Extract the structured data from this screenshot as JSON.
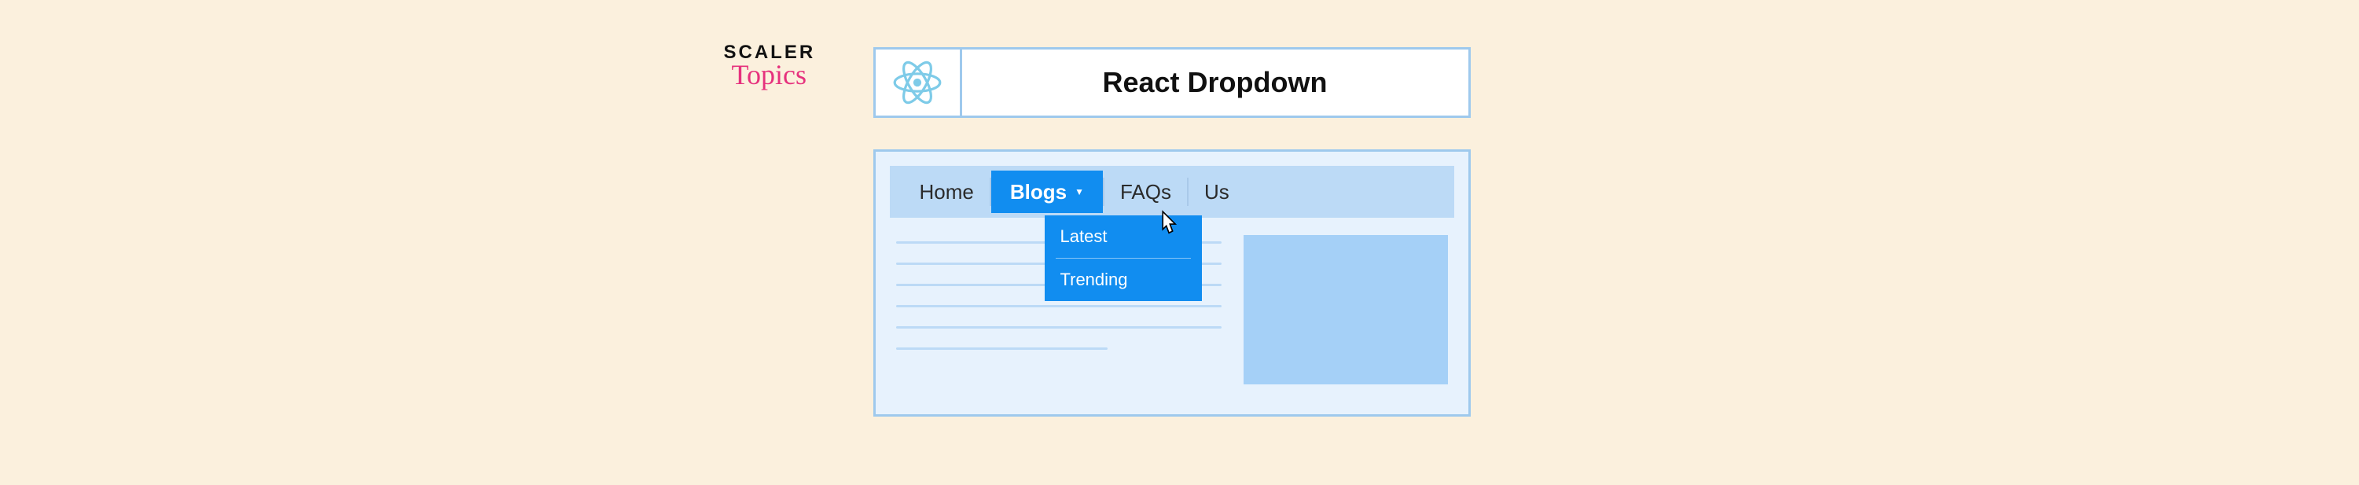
{
  "logo": {
    "scaler": "SCALER",
    "topics": "Topics"
  },
  "titlebar": {
    "title": "React Dropdown",
    "icon": "react-icon"
  },
  "nav": {
    "items": [
      {
        "label": "Home",
        "active": false
      },
      {
        "label": "Blogs",
        "active": true
      },
      {
        "label": "FAQs",
        "active": false
      },
      {
        "label": "Us",
        "active": false
      }
    ]
  },
  "dropdown": {
    "items": [
      {
        "label": "Latest"
      },
      {
        "label": "Trending"
      }
    ]
  },
  "colors": {
    "background": "#fbf0dd",
    "panel_border": "#9ec9ed",
    "panel_bg": "#e7f2fd",
    "nav_bg": "#bcdaf6",
    "accent": "#118df0",
    "pink": "#e6317d"
  }
}
